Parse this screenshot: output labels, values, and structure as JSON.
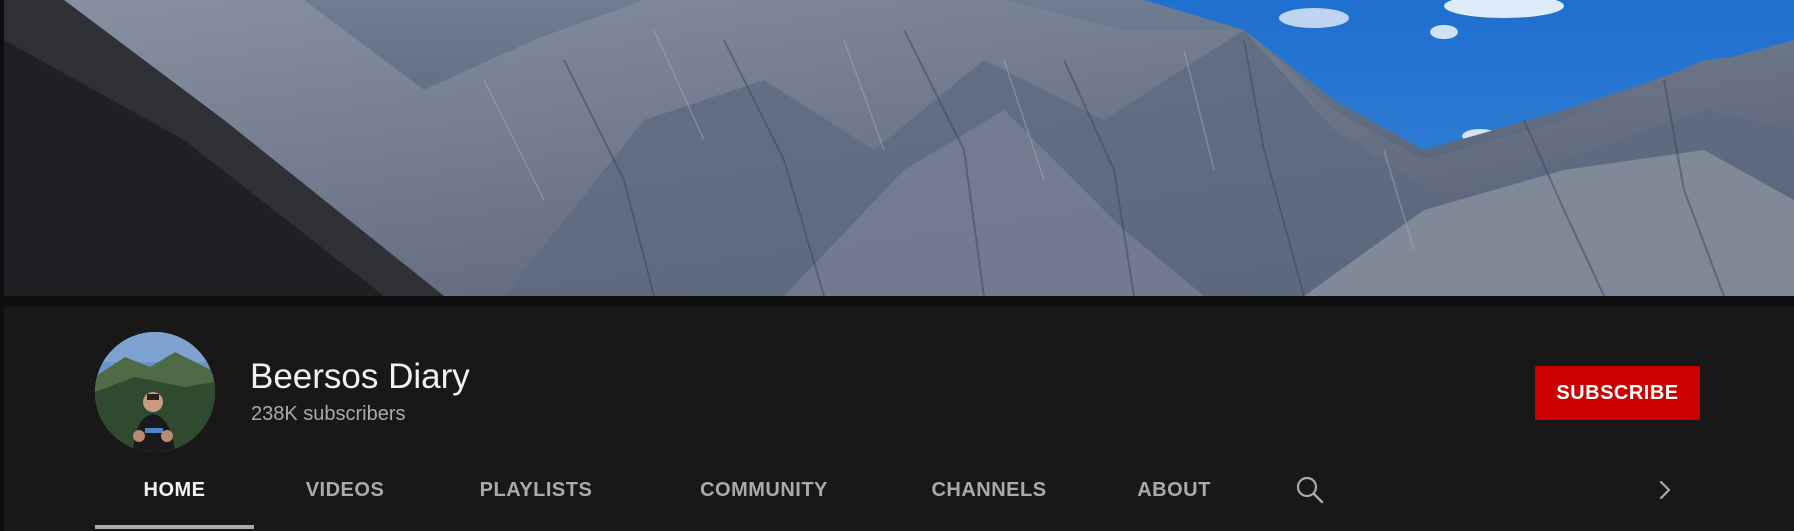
{
  "channel": {
    "name": "Beersos Diary",
    "subscribers": "238K subscribers"
  },
  "actions": {
    "subscribe_label": "SUBSCRIBE"
  },
  "tabs": [
    {
      "label": "HOME",
      "active": true
    },
    {
      "label": "VIDEOS",
      "active": false
    },
    {
      "label": "PLAYLISTS",
      "active": false
    },
    {
      "label": "COMMUNITY",
      "active": false
    },
    {
      "label": "CHANNELS",
      "active": false
    },
    {
      "label": "ABOUT",
      "active": false
    }
  ],
  "icons": {
    "search": "search-icon",
    "next": "chevron-right-icon"
  },
  "colors": {
    "background": "#181818",
    "subscribe": "#cc0000",
    "active_tab": "#f1f1f1",
    "inactive_tab": "#aaaaaa"
  }
}
